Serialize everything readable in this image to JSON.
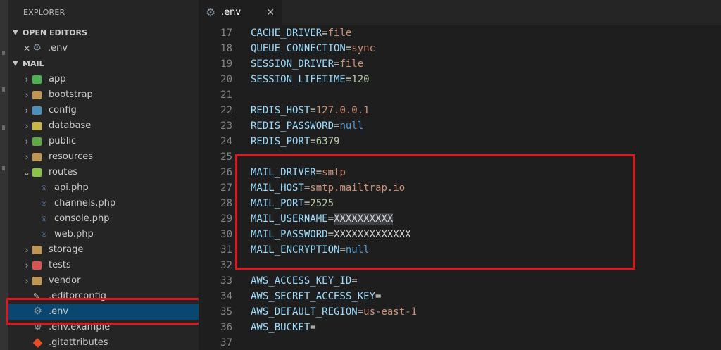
{
  "sidebar": {
    "title": "EXPLORER",
    "open_editors": {
      "label": "OPEN EDITORS",
      "items": [
        {
          "name": ".env",
          "close": "✕"
        }
      ]
    },
    "project": {
      "label": "MAIL",
      "tree": [
        {
          "label": "app",
          "type": "folder",
          "icon": "app-folder-icon",
          "color": "#4caf50"
        },
        {
          "label": "bootstrap",
          "type": "folder",
          "icon": "folder-icon",
          "color": "#c09553"
        },
        {
          "label": "config",
          "type": "folder",
          "icon": "config-folder-icon",
          "color": "#4a90b8"
        },
        {
          "label": "database",
          "type": "folder",
          "icon": "database-folder-icon",
          "color": "#c8b84a"
        },
        {
          "label": "public",
          "type": "folder",
          "icon": "public-folder-icon",
          "color": "#5fa845"
        },
        {
          "label": "resources",
          "type": "folder",
          "icon": "folder-icon",
          "color": "#c09553"
        },
        {
          "label": "routes",
          "type": "folder-open",
          "icon": "routes-folder-icon",
          "color": "#8bc34a"
        },
        {
          "label": "api.php",
          "type": "file",
          "icon": "php-icon"
        },
        {
          "label": "channels.php",
          "type": "file",
          "icon": "php-icon"
        },
        {
          "label": "console.php",
          "type": "file",
          "icon": "php-icon"
        },
        {
          "label": "web.php",
          "type": "file",
          "icon": "php-icon"
        },
        {
          "label": "storage",
          "type": "folder",
          "icon": "folder-icon",
          "color": "#c09553"
        },
        {
          "label": "tests",
          "type": "folder",
          "icon": "tests-folder-icon",
          "color": "#d9534f"
        },
        {
          "label": "vendor",
          "type": "folder",
          "icon": "folder-icon",
          "color": "#c09553"
        },
        {
          "label": ".editorconfig",
          "type": "root-file",
          "icon": "editorconfig-icon"
        },
        {
          "label": ".env",
          "type": "root-file",
          "icon": "gear-icon",
          "selected": true
        },
        {
          "label": ".env.example",
          "type": "root-file",
          "icon": "gear-icon"
        },
        {
          "label": ".gitattributes",
          "type": "root-file",
          "icon": "git-icon"
        }
      ]
    }
  },
  "tab": {
    "label": ".env",
    "icon": "gear-icon",
    "close": "✕"
  },
  "editor": {
    "lines": [
      {
        "n": "17",
        "key": "CACHE_DRIVER",
        "val": "file",
        "vt": "str"
      },
      {
        "n": "18",
        "key": "QUEUE_CONNECTION",
        "val": "sync",
        "vt": "str"
      },
      {
        "n": "19",
        "key": "SESSION_DRIVER",
        "val": "file",
        "vt": "str"
      },
      {
        "n": "20",
        "key": "SESSION_LIFETIME",
        "val": "120",
        "vt": "num"
      },
      {
        "n": "21",
        "key": "",
        "val": "",
        "vt": "empty"
      },
      {
        "n": "22",
        "key": "REDIS_HOST",
        "val": "127.0.0.1",
        "vt": "str"
      },
      {
        "n": "23",
        "key": "REDIS_PASSWORD",
        "val": "null",
        "vt": "kw"
      },
      {
        "n": "24",
        "key": "REDIS_PORT",
        "val": "6379",
        "vt": "num"
      },
      {
        "n": "25",
        "key": "",
        "val": "",
        "vt": "empty"
      },
      {
        "n": "26",
        "key": "MAIL_DRIVER",
        "val": "smtp",
        "vt": "str"
      },
      {
        "n": "27",
        "key": "MAIL_HOST",
        "val": "smtp.mailtrap.io",
        "vt": "str"
      },
      {
        "n": "28",
        "key": "MAIL_PORT",
        "val": "2525",
        "vt": "num"
      },
      {
        "n": "29",
        "key": "MAIL_USERNAME",
        "val": "XXXXXXXXXX",
        "vt": "masked"
      },
      {
        "n": "30",
        "key": "MAIL_PASSWORD",
        "val": "XXXXXXXXXXXXX",
        "vt": "plain"
      },
      {
        "n": "31",
        "key": "MAIL_ENCRYPTION",
        "val": "null",
        "vt": "kw"
      },
      {
        "n": "32",
        "key": "",
        "val": "",
        "vt": "empty"
      },
      {
        "n": "33",
        "key": "AWS_ACCESS_KEY_ID",
        "val": "",
        "vt": "str"
      },
      {
        "n": "34",
        "key": "AWS_SECRET_ACCESS_KEY",
        "val": "",
        "vt": "str"
      },
      {
        "n": "35",
        "key": "AWS_DEFAULT_REGION",
        "val": "us-east-1",
        "vt": "str"
      },
      {
        "n": "36",
        "key": "AWS_BUCKET",
        "val": "",
        "vt": "str"
      },
      {
        "n": "37",
        "key": "",
        "val": "",
        "vt": "empty"
      }
    ]
  },
  "colors": {
    "highlight": "#e0161e",
    "selection": "#094771"
  }
}
